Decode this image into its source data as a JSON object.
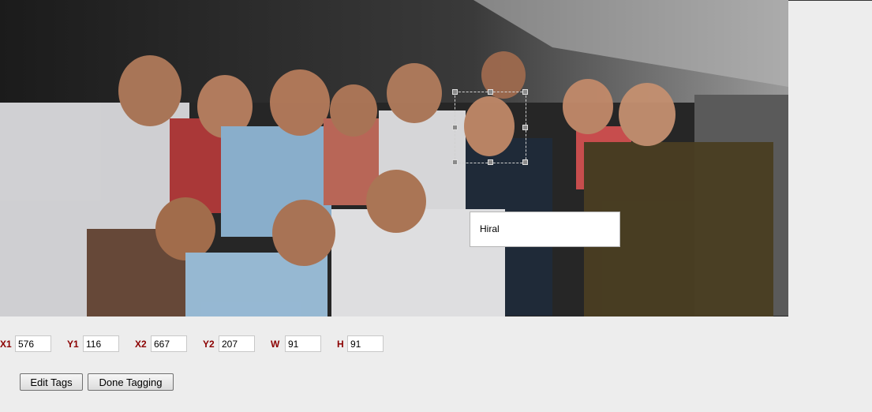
{
  "photo": {
    "description_icon": "group-photo",
    "crop_region_label": "face-selection"
  },
  "tag": {
    "name": "Hiral"
  },
  "coordinates": [
    {
      "key": "x1",
      "label": "X1",
      "value": "576"
    },
    {
      "key": "y1",
      "label": "Y1",
      "value": "116"
    },
    {
      "key": "x2",
      "label": "X2",
      "value": "667"
    },
    {
      "key": "y2",
      "label": "Y2",
      "value": "207"
    },
    {
      "key": "w",
      "label": "W",
      "value": "91"
    },
    {
      "key": "h",
      "label": "H",
      "value": "91"
    }
  ],
  "buttons": {
    "edit_tags": "Edit Tags",
    "done_tagging": "Done Tagging"
  },
  "colors": {
    "coord_label": "#8b0000",
    "page_background": "#ededed"
  }
}
